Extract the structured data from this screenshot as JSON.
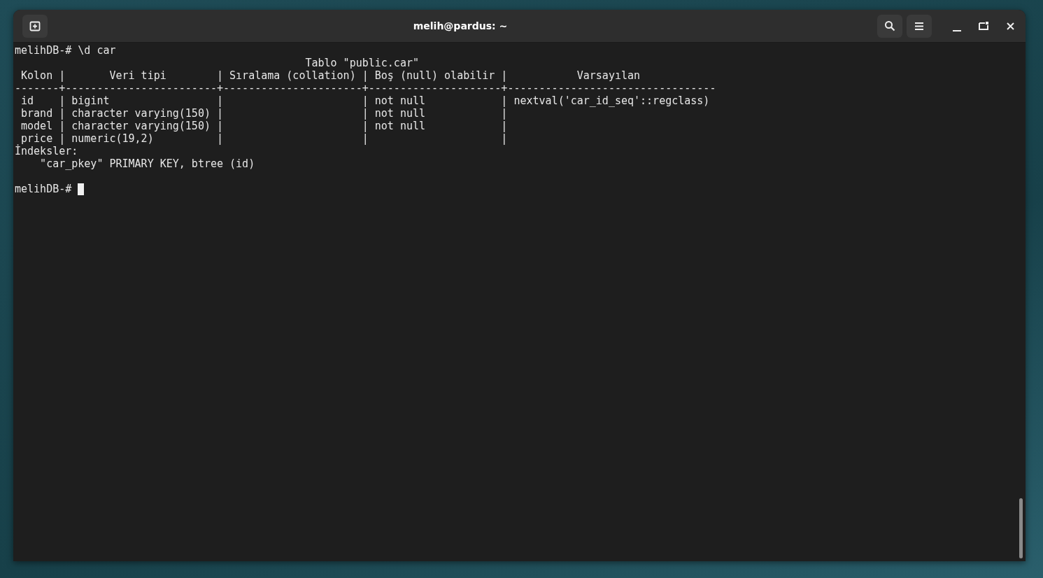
{
  "window": {
    "title": "melih@pardus: ~"
  },
  "terminal": {
    "lines": [
      "melihDB-# \\d car",
      "                                              Tablo \"public.car\"",
      " Kolon |       Veri tipi        | Sıralama (collation) | Boş (null) olabilir |           Varsayılan",
      "-------+------------------------+----------------------+---------------------+---------------------------------",
      " id    | bigint                 |                      | not null            | nextval('car_id_seq'::regclass)",
      " brand | character varying(150) |                      | not null            |",
      " model | character varying(150) |                      | not null            |",
      " price | numeric(19,2)          |                      |                     |",
      "İndeksler:",
      "    \"car_pkey\" PRIMARY KEY, btree (id)"
    ],
    "prompt": "melihDB-#"
  }
}
